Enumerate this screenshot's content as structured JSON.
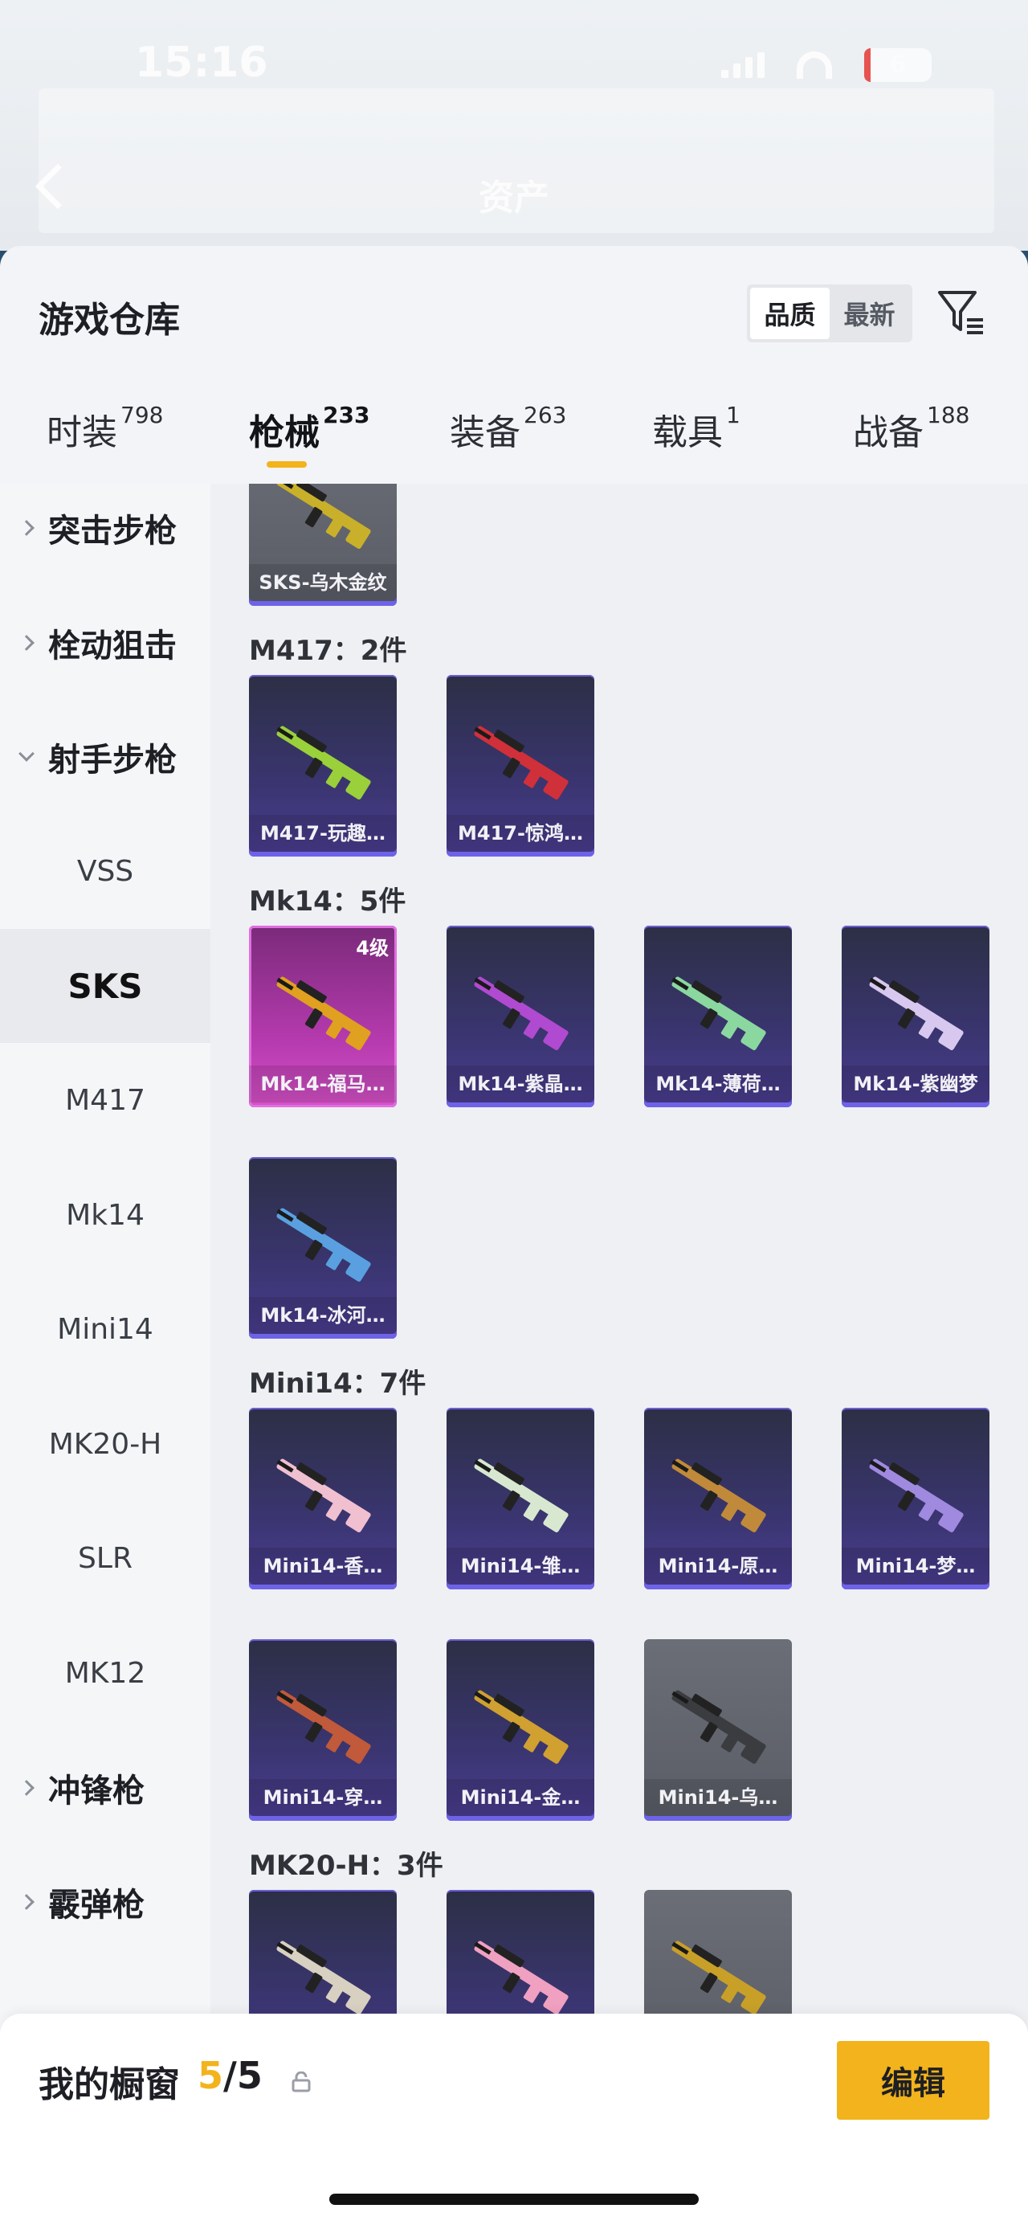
{
  "status_bar": {
    "time": "15:16",
    "battery": "6"
  },
  "nav": {
    "title": "资产"
  },
  "header": {
    "title": "游戏仓库",
    "sort": {
      "options": [
        "品质",
        "最新"
      ],
      "active": "品质"
    }
  },
  "category_tabs": [
    {
      "label": "时装",
      "count": "798"
    },
    {
      "label": "枪械",
      "count": "233",
      "active": true
    },
    {
      "label": "装备",
      "count": "263"
    },
    {
      "label": "载具",
      "count": "1"
    },
    {
      "label": "战备",
      "count": "188"
    }
  ],
  "sidebar": {
    "items": [
      {
        "label": "突击步枪",
        "type": "group",
        "expanded": false
      },
      {
        "label": "栓动狙击",
        "type": "group",
        "expanded": false
      },
      {
        "label": "射手步枪",
        "type": "group",
        "expanded": true
      },
      {
        "label": "VSS",
        "type": "sub"
      },
      {
        "label": "SKS",
        "type": "sub",
        "selected": true
      },
      {
        "label": "M417",
        "type": "sub"
      },
      {
        "label": "Mk14",
        "type": "sub"
      },
      {
        "label": "Mini14",
        "type": "sub"
      },
      {
        "label": "MK20-H",
        "type": "sub"
      },
      {
        "label": "SLR",
        "type": "sub"
      },
      {
        "label": "MK12",
        "type": "sub"
      },
      {
        "label": "冲锋枪",
        "type": "group",
        "expanded": false
      },
      {
        "label": "霰弹枪",
        "type": "group",
        "expanded": false
      }
    ]
  },
  "content": {
    "groups": [
      {
        "title": "",
        "items": [
          {
            "label": "SKS-乌木金纹",
            "style": "gray",
            "gun_color": "#c9b02a"
          }
        ]
      },
      {
        "title": "M417：2件",
        "items": [
          {
            "label": "M417-玩趣…",
            "style": "purple",
            "gun_color": "#9ad03a"
          },
          {
            "label": "M417-惊鸿…",
            "style": "purple",
            "gun_color": "#d0303a"
          }
        ]
      },
      {
        "title": "Mk14：5件",
        "items": [
          {
            "label": "Mk14-福马…",
            "style": "pink",
            "gun_color": "#e0a020",
            "level": "4级"
          },
          {
            "label": "Mk14-紫晶…",
            "style": "purple",
            "gun_color": "#b04ad0"
          },
          {
            "label": "Mk14-薄荷…",
            "style": "purple",
            "gun_color": "#8ad8a0"
          },
          {
            "label": "Mk14-紫幽梦",
            "style": "purple",
            "gun_color": "#d8c8f0"
          },
          {
            "label": "Mk14-冰河…",
            "style": "purple",
            "gun_color": "#5aa0e0"
          }
        ]
      },
      {
        "title": "Mini14：7件",
        "items": [
          {
            "label": "Mini14-香…",
            "style": "purple",
            "gun_color": "#f0c0d0"
          },
          {
            "label": "Mini14-雏…",
            "style": "purple",
            "gun_color": "#d8e8d0"
          },
          {
            "label": "Mini14-原…",
            "style": "purple",
            "gun_color": "#c08a3a"
          },
          {
            "label": "Mini14-梦…",
            "style": "purple",
            "gun_color": "#a08ae0"
          },
          {
            "label": "Mini14-穿…",
            "style": "purple",
            "gun_color": "#c05a3a"
          },
          {
            "label": "Mini14-金…",
            "style": "purple",
            "gun_color": "#d0a030"
          },
          {
            "label": "Mini14-乌…",
            "style": "gray",
            "gun_color": "#3a3c40"
          }
        ]
      },
      {
        "title": "MK20-H：3件",
        "items": [
          {
            "label": "",
            "style": "purple",
            "gun_color": "#d8d0c0"
          },
          {
            "label": "",
            "style": "purple",
            "gun_color": "#f0a0c0"
          },
          {
            "label": "",
            "style": "gray",
            "gun_color": "#c8a028"
          }
        ]
      }
    ]
  },
  "bottom_bar": {
    "label": "我的橱窗",
    "count_current": "5",
    "count_total": "/5",
    "edit_label": "编辑"
  },
  "colors": {
    "accent": "#f2b31c",
    "card_purple": "#3a3570",
    "card_pink": "#b73bb0"
  }
}
